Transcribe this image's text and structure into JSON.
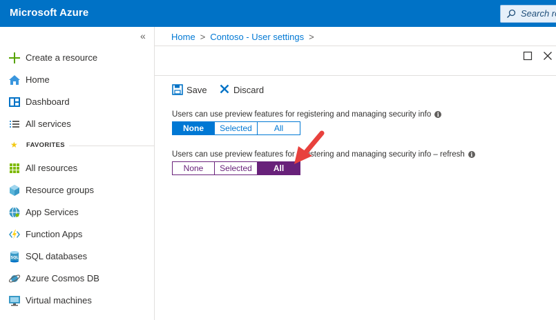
{
  "app": {
    "title": "Microsoft Azure",
    "search_placeholder": "Search re"
  },
  "sidebar": {
    "collapse_glyph": "«",
    "items": [
      {
        "label": "Create a resource",
        "icon": "plus-icon"
      },
      {
        "label": "Home",
        "icon": "home-icon"
      },
      {
        "label": "Dashboard",
        "icon": "dashboard-icon"
      },
      {
        "label": "All services",
        "icon": "list-icon"
      }
    ],
    "favorites_label": "FAVORITES",
    "favorites": [
      {
        "label": "All resources",
        "icon": "grid-icon"
      },
      {
        "label": "Resource groups",
        "icon": "cube-icon"
      },
      {
        "label": "App Services",
        "icon": "globe-icon"
      },
      {
        "label": "Function Apps",
        "icon": "lightning-icon"
      },
      {
        "label": "SQL databases",
        "icon": "database-icon"
      },
      {
        "label": "Azure Cosmos DB",
        "icon": "planet-icon"
      },
      {
        "label": "Virtual machines",
        "icon": "monitor-icon"
      }
    ]
  },
  "breadcrumb": {
    "home": "Home",
    "page": "Contoso - User settings",
    "separator": ">"
  },
  "toolbar": {
    "save_label": "Save",
    "discard_label": "Discard"
  },
  "settings": [
    {
      "label": "Users can use preview features for registering and managing security info",
      "options": [
        "None",
        "Selected",
        "All"
      ],
      "selected": "None"
    },
    {
      "label": "Users can use preview features for registering and managing security info – refresh",
      "options": [
        "None",
        "Selected",
        "All"
      ],
      "selected": "All"
    }
  ],
  "colors": {
    "topbar": "#0072c6",
    "accent_blue": "#0078d4",
    "accent_purple": "#68217a",
    "annotation_arrow": "#e8413d"
  }
}
